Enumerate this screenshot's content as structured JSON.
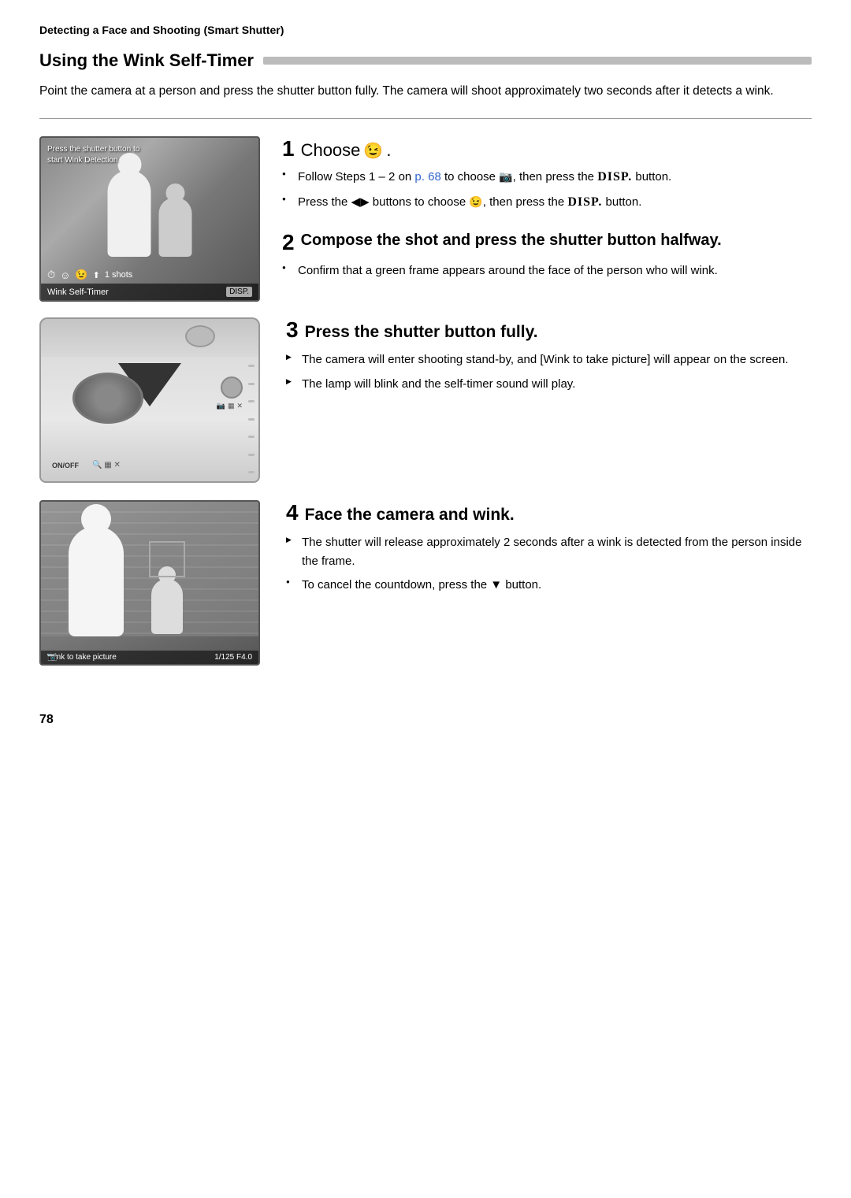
{
  "page": {
    "top_label": "Detecting a Face and Shooting (Smart Shutter)",
    "section_title": "Using the Wink Self-Timer",
    "intro": "Point the camera at a person and press the shutter button fully. The camera will shoot approximately two seconds after it detects a wink.",
    "page_number": "78"
  },
  "step1": {
    "number": "1",
    "title": "Choose",
    "icon_label": "wink-self-timer-icon",
    "bullets": [
      {
        "type": "circle",
        "text": "Follow Steps 1 – 2 on p. 68 to choose",
        "link": "p. 68",
        "suffix": ", then press the DISP. button."
      },
      {
        "type": "circle",
        "text": "Press the ◀▶ buttons to choose",
        "suffix": ", then press the DISP. button."
      }
    ]
  },
  "step2": {
    "number": "2",
    "title": "Compose the shot and press the shutter button halfway.",
    "bullets": [
      {
        "type": "circle",
        "text": "Confirm that a green frame appears around the face of the person who will wink."
      }
    ]
  },
  "step3": {
    "number": "3",
    "title": "Press the shutter button fully.",
    "bullets": [
      {
        "type": "triangle",
        "text": "The camera will enter shooting stand-by, and [Wink to take picture] will appear on the screen."
      },
      {
        "type": "triangle",
        "text": "The lamp will blink and the self-timer sound will play."
      }
    ]
  },
  "step4": {
    "number": "4",
    "title": "Face the camera and wink.",
    "bullets": [
      {
        "type": "triangle",
        "text": "The shutter will release approximately 2 seconds after a wink is detected from the person inside the frame."
      },
      {
        "type": "circle",
        "text": "To cancel the countdown, press the ▼ button."
      }
    ]
  },
  "camera_screen1": {
    "overlay_line1": "Press the shutter button to",
    "overlay_line2": "start Wink Detection",
    "bottom_label": "Wink Self-Timer",
    "shots_label": "1 shots",
    "disp_badge": "DISP."
  },
  "camera_screen4": {
    "bottom_label": "Wink to take picture",
    "bottom_right": "1/125  F4.0"
  },
  "icons": {
    "bullet_circle": "●",
    "bullet_triangle": "▶",
    "wink_icon": "☺",
    "disp": "DISP"
  }
}
